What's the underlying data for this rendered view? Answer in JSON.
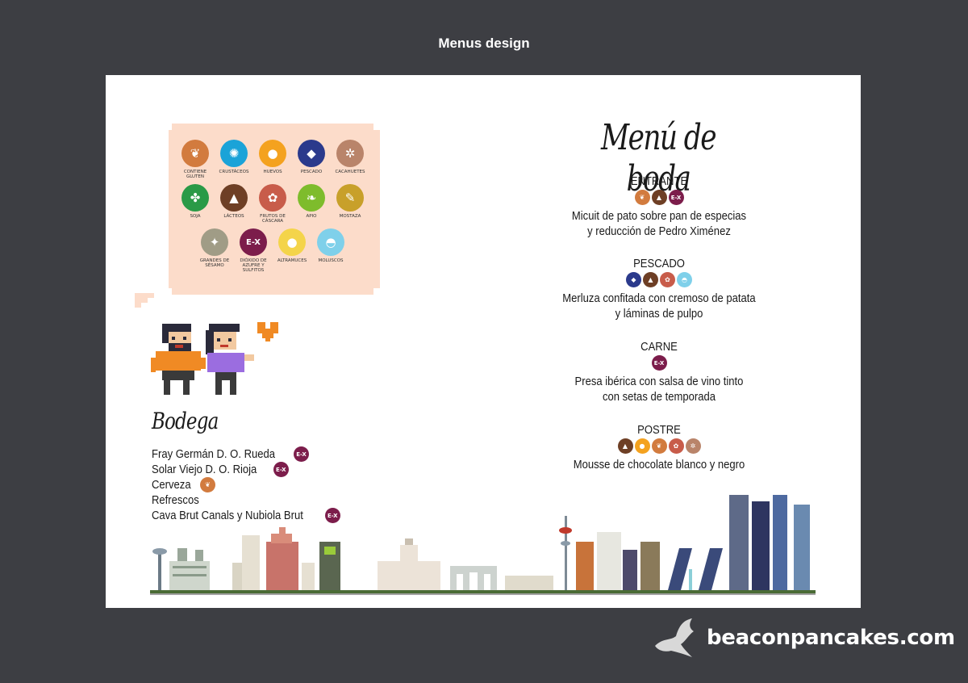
{
  "header": {
    "title": "Menus design"
  },
  "legend": {
    "rows": [
      [
        {
          "label": "CONTIENE GLUTEN",
          "icon": "wheat-icon",
          "color": "#d27b3e",
          "glyph": "❦"
        },
        {
          "label": "CRUSTÁCEOS",
          "icon": "crab-icon",
          "color": "#1ba3d8",
          "glyph": "✺"
        },
        {
          "label": "HUEVOS",
          "icon": "eggs-icon",
          "color": "#f4a21f",
          "glyph": "●"
        },
        {
          "label": "PESCADO",
          "icon": "fish-icon",
          "color": "#2b3a8c",
          "glyph": "◆"
        },
        {
          "label": "CACAHUETES",
          "icon": "peanut-icon",
          "color": "#b9846a",
          "glyph": "✲"
        }
      ],
      [
        {
          "label": "SOJA",
          "icon": "soy-icon",
          "color": "#2a9a47",
          "glyph": "✤"
        },
        {
          "label": "LÁCTEOS",
          "icon": "milk-icon",
          "color": "#6e3f25",
          "glyph": "▲"
        },
        {
          "label": "FRUTOS DE CÁSCARA",
          "icon": "nut-icon",
          "color": "#c85c4a",
          "glyph": "✿"
        },
        {
          "label": "APIO",
          "icon": "celery-icon",
          "color": "#7ebc2c",
          "glyph": "❧"
        },
        {
          "label": "MOSTAZA",
          "icon": "mustard-icon",
          "color": "#c8a02a",
          "glyph": "✎"
        }
      ],
      [
        {
          "label": "GRANDES DE SÉSAMO",
          "icon": "sesame-icon",
          "color": "#a09c86",
          "glyph": "✦"
        },
        {
          "label": "DIÓXIDO DE AZUFRE Y SULFITOS",
          "icon": "sulphite-icon",
          "color": "#7c1d4b",
          "glyph": "E-X"
        },
        {
          "label": "ALTRAMUCES",
          "icon": "lupin-icon",
          "color": "#f4d44a",
          "glyph": "●"
        },
        {
          "label": "MOLUSCOS",
          "icon": "shell-icon",
          "color": "#7fd0ea",
          "glyph": "◓"
        }
      ]
    ]
  },
  "bodega": {
    "title": "Bodega",
    "items": [
      {
        "text": "Fray Germán D. O. Rueda",
        "icon": "sulphite-icon",
        "color": "#7c1d4b",
        "glyph": "E-X"
      },
      {
        "text": "Solar Viejo D. O. Rioja",
        "icon": "sulphite-icon",
        "color": "#7c1d4b",
        "glyph": "E-X"
      },
      {
        "text": "Cerveza",
        "icon": "wheat-icon",
        "color": "#d27b3e",
        "glyph": "❦"
      },
      {
        "text": "Refrescos",
        "icon": "",
        "color": "",
        "glyph": ""
      },
      {
        "text": "Cava Brut Canals y Nubiola Brut",
        "icon": "sulphite-icon",
        "color": "#7c1d4b",
        "glyph": "E-X"
      }
    ]
  },
  "menu": {
    "title": "Menú de boda",
    "courses": [
      {
        "name": "ENTRANTE",
        "dish1": "Micuit de pato sobre pan de especias",
        "dish2": "y reducción de Pedro Ximénez",
        "icons": [
          {
            "icon": "wheat-icon",
            "color": "#d27b3e",
            "glyph": "❦"
          },
          {
            "icon": "milk-icon",
            "color": "#6e3f25",
            "glyph": "▲"
          },
          {
            "icon": "sulphite-icon",
            "color": "#7c1d4b",
            "glyph": "E-X"
          }
        ]
      },
      {
        "name": "PESCADO",
        "dish1": "Merluza confitada con cremoso de patata",
        "dish2": "y láminas de pulpo",
        "icons": [
          {
            "icon": "fish-icon",
            "color": "#2b3a8c",
            "glyph": "◆"
          },
          {
            "icon": "milk-icon",
            "color": "#6e3f25",
            "glyph": "▲"
          },
          {
            "icon": "nut-icon",
            "color": "#c85c4a",
            "glyph": "✿"
          },
          {
            "icon": "shell-icon",
            "color": "#7fd0ea",
            "glyph": "◓"
          }
        ]
      },
      {
        "name": "CARNE",
        "dish1": "Presa ibérica con salsa de vino tinto",
        "dish2": "con setas de temporada",
        "icons": [
          {
            "icon": "sulphite-icon",
            "color": "#7c1d4b",
            "glyph": "E-X"
          }
        ]
      },
      {
        "name": "POSTRE",
        "dish1": "Mousse de chocolate blanco y negro",
        "dish2": "",
        "icons": [
          {
            "icon": "milk-icon",
            "color": "#6e3f25",
            "glyph": "▲"
          },
          {
            "icon": "eggs-icon",
            "color": "#f4a21f",
            "glyph": "●"
          },
          {
            "icon": "wheat-icon",
            "color": "#d27b3e",
            "glyph": "❦"
          },
          {
            "icon": "nut-icon",
            "color": "#c85c4a",
            "glyph": "✿"
          },
          {
            "icon": "peanut-icon",
            "color": "#b9846a",
            "glyph": "✲"
          }
        ]
      }
    ]
  },
  "brand": {
    "text": "beaconpancakes.com"
  }
}
